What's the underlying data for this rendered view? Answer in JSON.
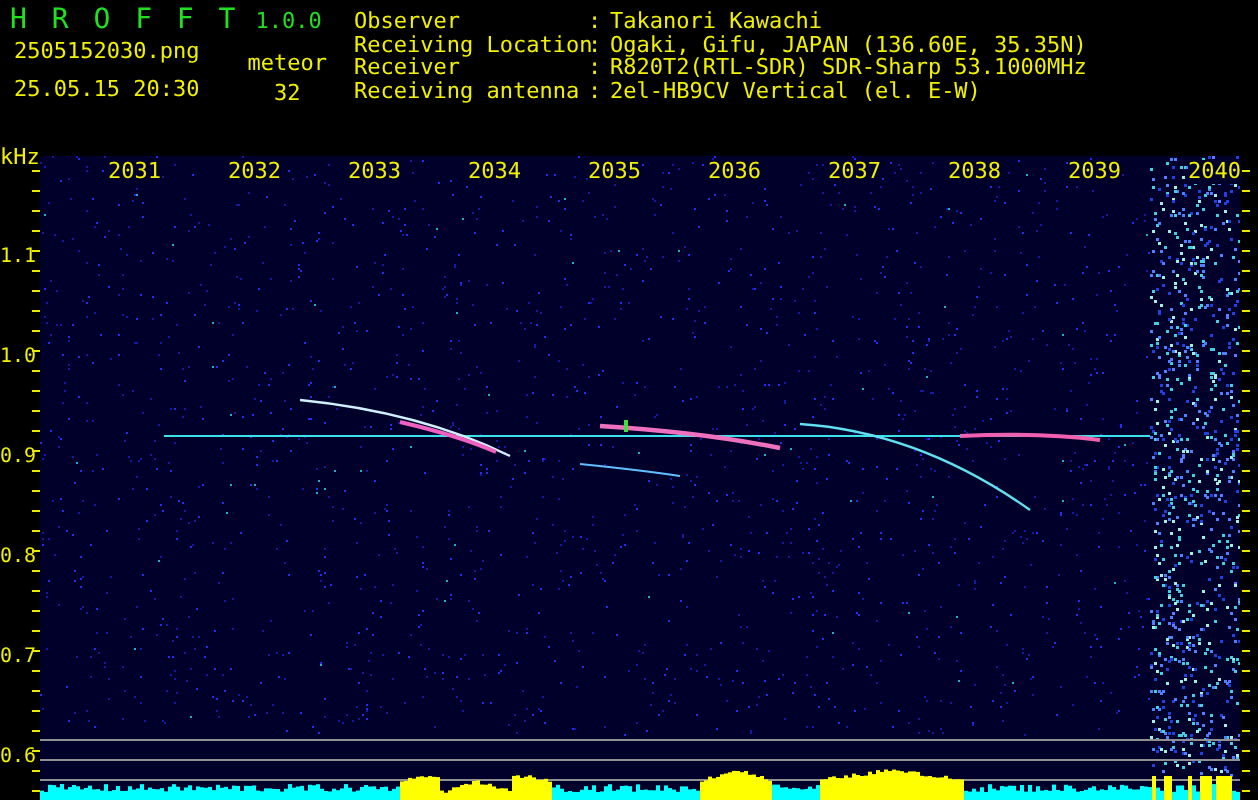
{
  "app": {
    "name": "H R O F F T",
    "version": "1.0.0"
  },
  "file": {
    "filename": "2505152030.png",
    "timestamp": "25.05.15 20:30"
  },
  "meteor": {
    "label": "meteor",
    "count": "32"
  },
  "station_info": [
    {
      "label": "Observer",
      "separator": ":",
      "value": "Takanori Kawachi"
    },
    {
      "label": "Receiving Location",
      "separator": ":",
      "value": "Ogaki, Gifu, JAPAN (136.60E, 35.35N)"
    },
    {
      "label": "Receiver",
      "separator": ":",
      "value": "R820T2(RTL-SDR) SDR-Sharp 53.1000MHz"
    },
    {
      "label": "Receiving antenna",
      "separator": ":",
      "value": "2el-HB9CV Vertical (el. E-W)"
    }
  ],
  "spectrogram": {
    "frequency_unit": "kHz",
    "time_labels": [
      "2031",
      "2032",
      "2033",
      "2034",
      "2035",
      "2036",
      "2037",
      "2038",
      "2039",
      "2040"
    ],
    "frequency_labels": [
      "1.1",
      "1.0",
      "0.9",
      "0.8",
      "0.7",
      "0.6"
    ]
  }
}
